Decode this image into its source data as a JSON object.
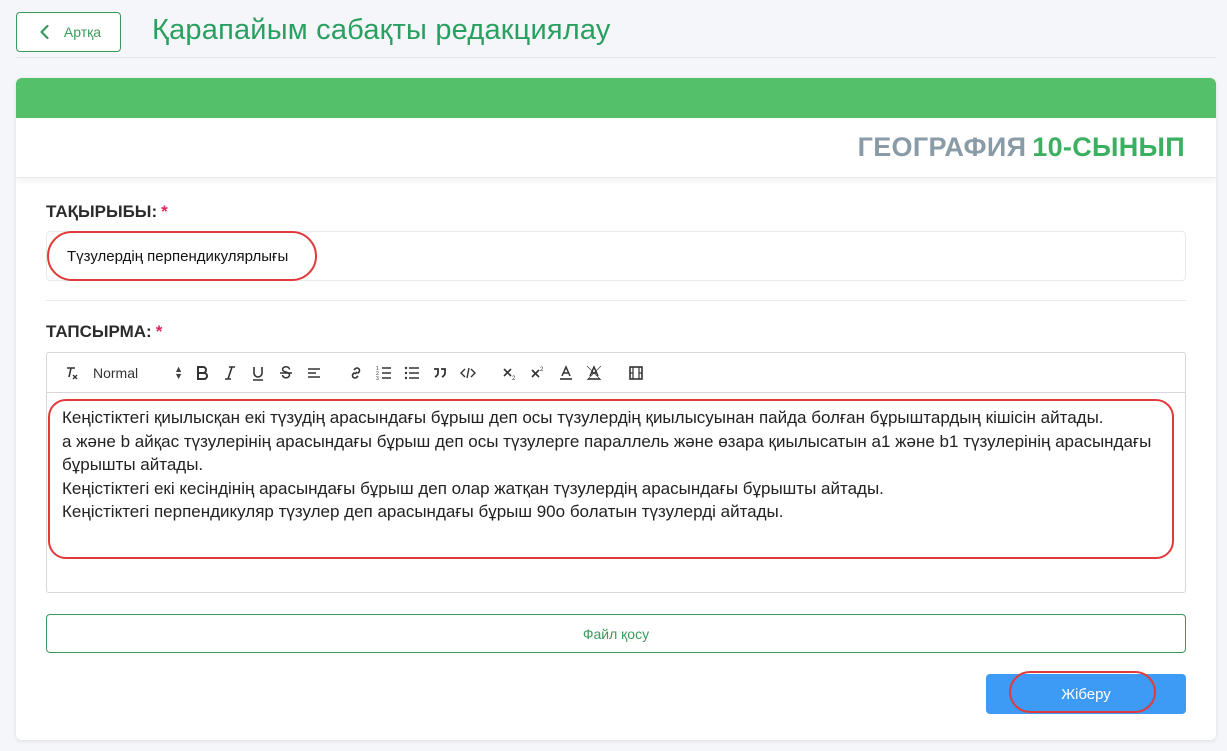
{
  "header": {
    "back_label": "Артқа",
    "title": "Қарапайым сабақты редакциялау"
  },
  "card": {
    "subject_part1": "ГЕОГРАФИЯ",
    "subject_part2": "10-СЫНЫП"
  },
  "topic": {
    "label": "ТАҚЫРЫБЫ:",
    "required_mark": "*",
    "value": "Түзулердің перпендикулярлығы"
  },
  "task": {
    "label": "ТАПСЫРМА:",
    "required_mark": "*",
    "heading_select": "Normal",
    "paragraphs": [
      "Кеңістіктегі қиылысқан екі түзудің арасындағы бұрыш деп осы түзулердің қиылысуынан пайда болған бұрыштардың кішісін айтады.",
      "а және b айқас түзулерінің арасындағы бұрыш деп осы түзулерге параллель және өзара қиылысатын а1 және b1 түзулерінің арасындағы бұрышты айтады.",
      "Кеңістіктегі екі кесіндінің арасындағы бұрыш деп олар жатқан түзулердің арасындағы бұрышты айтады.",
      "Кеңістіктегі перпендикуляр түзулер деп арасындағы бұрыш 90о болатын түзулерді айтады."
    ]
  },
  "buttons": {
    "add_file": "Файл қосу",
    "submit": "Жіберу"
  },
  "colors": {
    "brand_green": "#55c06a",
    "title_green": "#2aa060",
    "submit_blue": "#3d9bf5",
    "highlight_red": "#e23a3a"
  }
}
